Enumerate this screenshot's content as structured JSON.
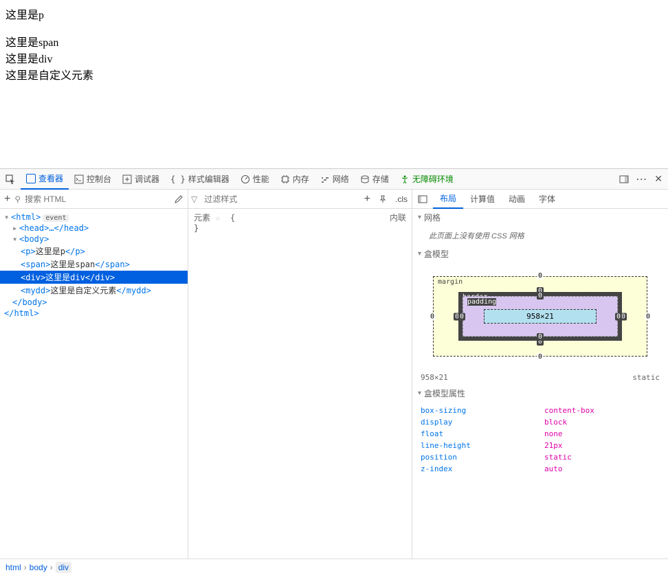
{
  "page": {
    "p_text": "这里是p",
    "span_text": "这里是span",
    "div_text": "这里是div",
    "custom_text": "这里是自定义元素"
  },
  "tabs": {
    "inspector": "查看器",
    "console": "控制台",
    "debugger": "调试器",
    "styles": "样式编辑器",
    "performance": "性能",
    "memory": "内存",
    "network": "网络",
    "storage": "存储",
    "accessibility": "无障碍环境"
  },
  "search_placeholder": "搜索 HTML",
  "filter_placeholder": "过滤样式",
  "cls_label": ".cls",
  "dom": {
    "html_open": "<html>",
    "event_badge": "event",
    "head": "<head>…</head>",
    "body_open": "<body>",
    "p_open": "<p>",
    "p_text": "这里是p",
    "p_close": "</p>",
    "span_open": "<span>",
    "span_text": "这里是span",
    "span_close": "</span>",
    "div_open": "<div>",
    "div_text": "这里是div",
    "div_close": "</div>",
    "mydd_open": "<mydd>",
    "mydd_text": "这里是自定义元素",
    "mydd_close": "</mydd>",
    "body_close": "</body>",
    "html_close": "</html>"
  },
  "rules": {
    "element_label": "元素",
    "inline_label": "内联",
    "brace_open": "{",
    "brace_close": "}",
    "icon_placeholder": "☆"
  },
  "right_tabs": {
    "layout": "布局",
    "computed": "计算值",
    "animation": "动画",
    "font": "字体"
  },
  "grid_section": "网格",
  "grid_msg": "此页面上没有使用 CSS 网格",
  "boxmodel_section": "盒模型",
  "boxmodel": {
    "margin_label": "margin",
    "border_label": "border",
    "padding_label": "padding",
    "content_size": "958×21",
    "margin_t": "0",
    "margin_r": "0",
    "margin_b": "0",
    "margin_l": "0",
    "border_t": "0",
    "border_r": "0",
    "border_b": "0",
    "border_l": "0",
    "padding_t": "0",
    "padding_r": "0",
    "padding_b": "0",
    "padding_l": "0"
  },
  "bm_summary_size": "958×21",
  "bm_summary_pos": "static",
  "bm_props_section": "盒模型属性",
  "props": [
    {
      "name": "box-sizing",
      "val": "content-box"
    },
    {
      "name": "display",
      "val": "block"
    },
    {
      "name": "float",
      "val": "none"
    },
    {
      "name": "line-height",
      "val": "21px"
    },
    {
      "name": "position",
      "val": "static"
    },
    {
      "name": "z-index",
      "val": "auto"
    }
  ],
  "breadcrumb": [
    "html",
    "body",
    "div"
  ]
}
